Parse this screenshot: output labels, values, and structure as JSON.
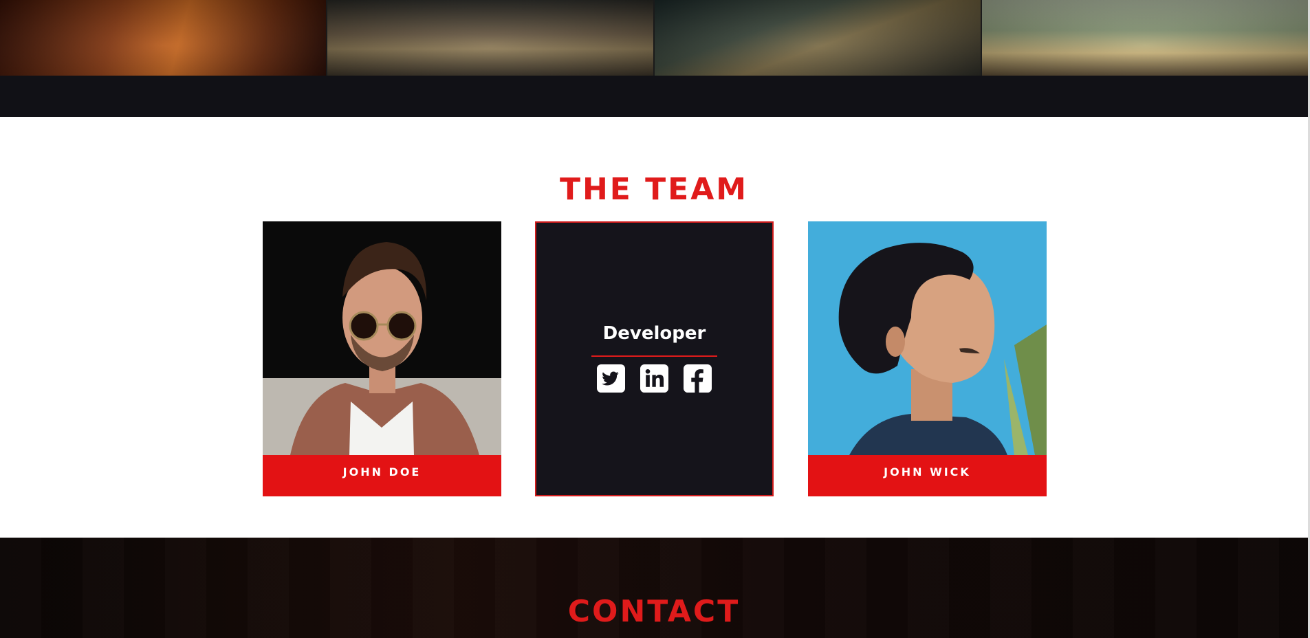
{
  "gallery": {
    "tiles": [
      {
        "name": "gallery-image-1"
      },
      {
        "name": "gallery-image-2"
      },
      {
        "name": "gallery-image-3"
      },
      {
        "name": "gallery-image-4"
      }
    ]
  },
  "team": {
    "title": "THE TEAM",
    "members": [
      {
        "name": "JOHN DOE"
      },
      {
        "role": "Developer",
        "social_icons": [
          "twitter-icon",
          "linkedin-icon",
          "facebook-icon"
        ]
      },
      {
        "name": "JOHN WICK"
      }
    ]
  },
  "contact": {
    "title": "CONTACT"
  },
  "colors": {
    "accent": "#e31214",
    "dark": "#111116",
    "card_dark": "#15141b",
    "white": "#ffffff"
  }
}
